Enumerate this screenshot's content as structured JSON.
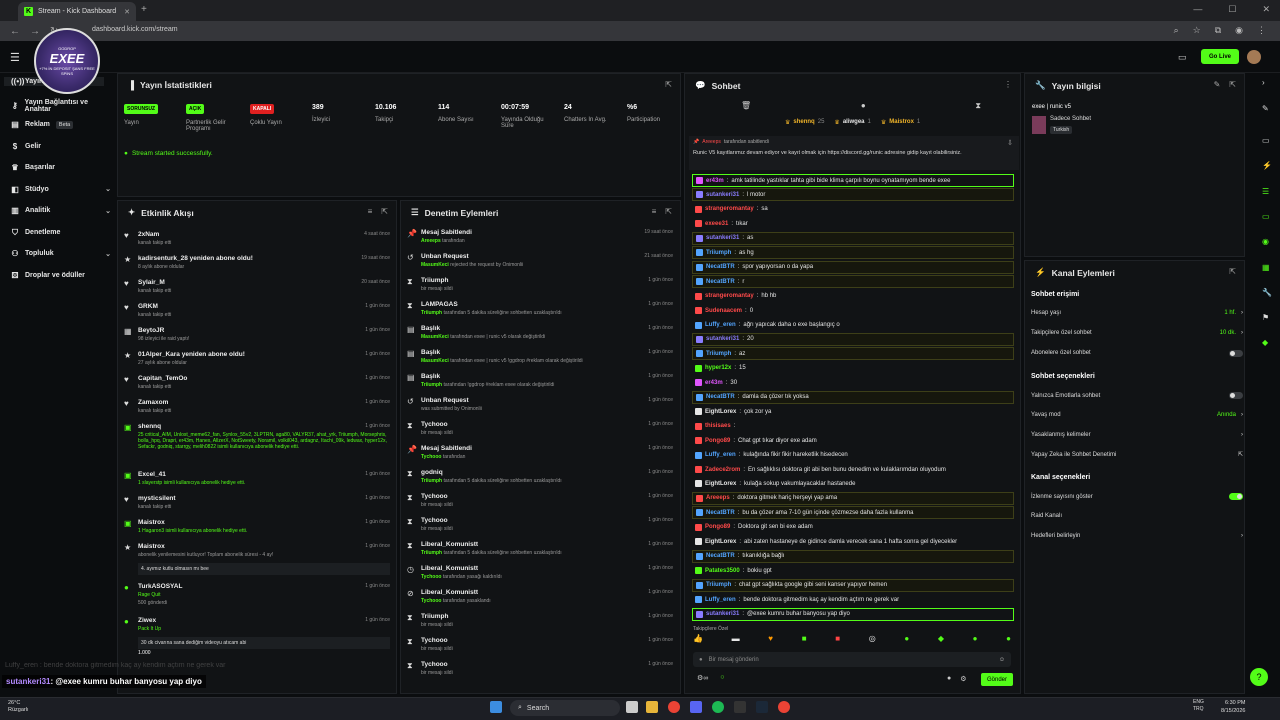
{
  "browser": {
    "tab_title": "Stream - Kick Dashboard",
    "url": "dashboard.kick.com/stream"
  },
  "header": {
    "golive": "Go Live"
  },
  "overlay": {
    "logo_top": "GODROP",
    "logo_name": "EXEE",
    "logo_sub": "+7% İN DEPOSIT ŞANS FREE SPİNS"
  },
  "sidebar": [
    {
      "label": "Yayın",
      "icon": "stream-icon",
      "chev": false
    },
    {
      "label": "Yayın Bağlantısı ve Anahtar",
      "icon": "key-icon",
      "chev": false
    },
    {
      "label": "Reklam",
      "icon": "ad-icon",
      "chev": false,
      "badge": "Beta"
    },
    {
      "label": "Gelir",
      "icon": "dollar-icon",
      "chev": false
    },
    {
      "label": "Başarılar",
      "icon": "trophy-icon",
      "chev": false
    },
    {
      "label": "Stüdyo",
      "icon": "studio-icon",
      "chev": true
    },
    {
      "label": "Analitik",
      "icon": "chart-icon",
      "chev": true
    },
    {
      "label": "Denetleme",
      "icon": "shield-icon",
      "chev": false
    },
    {
      "label": "Topluluk",
      "icon": "community-icon",
      "chev": true
    },
    {
      "label": "Droplar ve ödüller",
      "icon": "gift-icon",
      "chev": false
    }
  ],
  "stats": {
    "title": "Yayın İstatistikleri",
    "items": [
      {
        "badge": "SORUNSUZ",
        "label": "Yayın",
        "kind": "g"
      },
      {
        "badge": "AÇIK",
        "label": "Partnerlik Gelir Programı",
        "kind": "g"
      },
      {
        "badge": "KAPALI",
        "label": "Çoklu Yayın",
        "kind": "r"
      },
      {
        "value": "389",
        "label": "İzleyici"
      },
      {
        "value": "10.106",
        "label": "Takipçi"
      },
      {
        "value": "114",
        "label": "Abone Sayısı"
      },
      {
        "value": "00:07:59",
        "label": "Yayında Olduğu Süre"
      },
      {
        "value": "24",
        "label": "Chatters In Avg."
      },
      {
        "value": "%6",
        "label": "Participation"
      }
    ],
    "status": "Stream started successfully."
  },
  "activity": {
    "title": "Etkinlik Akışı",
    "rows": [
      {
        "icon": "♥",
        "name": "2xNam",
        "sub": "kanalı takip etti",
        "time": "4 saat önce"
      },
      {
        "icon": "★",
        "name": "kadirsenturk_28 yeniden abone oldu!",
        "sub": "8 aylık abone oldular",
        "time": "19 saat önce"
      },
      {
        "icon": "♥",
        "name": "Sylair_M",
        "sub": "kanalı takip etti",
        "time": "20 saat önce"
      },
      {
        "icon": "♥",
        "name": "GRKM",
        "sub": "kanalı takip etti",
        "time": "1 gün önce"
      },
      {
        "icon": "▦",
        "name": "BeytoJR",
        "sub": "98 izleyici ile raid yaptı!",
        "time": "1 gün önce"
      },
      {
        "icon": "★",
        "name": "01Alper_Kara yeniden abone oldu!",
        "sub": "27 aylık abone oldular",
        "time": "1 gün önce"
      },
      {
        "icon": "♥",
        "name": "Capitan_TemOo",
        "sub": "kanalı takip etti",
        "time": "1 gün önce"
      },
      {
        "icon": "♥",
        "name": "Zamaxom",
        "sub": "kanalı takip etti",
        "time": "1 gün önce"
      },
      {
        "icon": "▣",
        "name": "shennq",
        "sub": "25 critical_AIM, Unlost_meme62_fan, Synlox_55v2, 3LPTRN, aga80, VALYR37, ahat_yrk, Triiumph, Morsephris, bolla_hpq, Drapri, er43m, Hanex, AllzerX, NotSweety, Noramil, volkil043, ardagnz, Itachi_09k, ledwax, hyper12x, Sefackr, godniq, starrgy, melih0822 isimli kullanıcıya abonelik hediye etti.",
        "time": "1 gün önce"
      },
      {
        "icon": "▣",
        "name": "Excel_41",
        "sub": "1 slayerstp isimli kullanıcıya abonelik hediye etti.",
        "time": "1 gün önce"
      },
      {
        "icon": "♥",
        "name": "mysticsilent",
        "sub": "kanalı takip etti",
        "time": "1 gün önce"
      },
      {
        "icon": "▣",
        "name": "Maistrox",
        "sub": "1 Hagaron3 isimli kullanıcıya abonelik hediye etti.",
        "time": "1 gün önce"
      },
      {
        "icon": "★",
        "name": "Maistrox",
        "sub": "abonelik yenilemesini kutluyor! Toplam abonelik süresi - 4 ay!",
        "time": "1 gün önce",
        "quote": "4. ayımız kutlu olmasın mı bee"
      },
      {
        "icon": "●",
        "name": "TurkASOSYAL",
        "sub": "Rage Quit",
        "sub2": "500 gönderdi",
        "time": "1 gün önce"
      },
      {
        "icon": "●",
        "name": "Ziwex",
        "sub": "Pack It Up",
        "quote": "30 dk civarına sana dediğim videoyu atıcam abi",
        "amount": "1.000",
        "time": "1 gün önce"
      }
    ]
  },
  "moderation": {
    "title": "Denetim Eylemleri",
    "rows": [
      {
        "icon": "📌",
        "name": "Mesaj Sabitlendi",
        "actor": "Areeeps",
        "rest": "tarafından",
        "time": "19 saat önce"
      },
      {
        "icon": "↺",
        "name": "Unban Request",
        "actor": "MasumKeci",
        "rest": "rejected the request by Onimonlii",
        "time": "21 saat önce"
      },
      {
        "icon": "⧗",
        "name": "Triiumph",
        "actor": "",
        "rest": "bir mesajı sildi",
        "time": "1 gün önce"
      },
      {
        "icon": "⧗",
        "name": "LAMPAGAS",
        "actor": "Triiumph",
        "rest": "tarafından 5 dakika süreliğine sohbetten uzaklaştırıldı",
        "time": "1 gün önce"
      },
      {
        "icon": "▤",
        "name": "Başlık",
        "actor": "MasumKeci",
        "rest": "tarafından exee | runic v5 olarak değiştirildi",
        "time": "1 gün önce"
      },
      {
        "icon": "▤",
        "name": "Başlık",
        "actor": "MasumKeci",
        "rest": "tarafından exee | runic v5 !ggdrop #reklam olarak değiştirildi",
        "time": "1 gün önce"
      },
      {
        "icon": "▤",
        "name": "Başlık",
        "actor": "Triiumph",
        "rest": "tarafından !ggdrop #reklam exee olarak değiştirildi",
        "time": "1 gün önce"
      },
      {
        "icon": "↺",
        "name": "Unban Request",
        "actor": "",
        "rest": "was submitted by Onimonlii",
        "time": "1 gün önce"
      },
      {
        "icon": "⧗",
        "name": "Tychooo",
        "actor": "",
        "rest": "bir mesajı sildi",
        "time": "1 gün önce"
      },
      {
        "icon": "📌",
        "name": "Mesaj Sabitlendi",
        "actor": "Tychooo",
        "rest": "tarafından",
        "time": "1 gün önce"
      },
      {
        "icon": "⧗",
        "name": "godniq",
        "actor": "Triiumph",
        "rest": "tarafından 5 dakika süreliğine sohbetten uzaklaştırıldı",
        "time": "1 gün önce"
      },
      {
        "icon": "⧗",
        "name": "Tychooo",
        "actor": "",
        "rest": "bir mesajı sildi",
        "time": "1 gün önce"
      },
      {
        "icon": "⧗",
        "name": "Tychooo",
        "actor": "",
        "rest": "bir mesajı sildi",
        "time": "1 gün önce"
      },
      {
        "icon": "⧗",
        "name": "Liberal_Komunistt",
        "actor": "Triiumph",
        "rest": "tarafından 5 dakika süreliğine sohbetten uzaklaştırıldı",
        "time": "1 gün önce"
      },
      {
        "icon": "◷",
        "name": "Liberal_Komunistt",
        "actor": "Tychooo",
        "rest": "tarafından yasağı kaldırıldı",
        "time": "1 gün önce"
      },
      {
        "icon": "⊘",
        "name": "Liberal_Komunistt",
        "actor": "Tychooo",
        "rest": "tarafından yasaklandı",
        "time": "1 gün önce"
      },
      {
        "icon": "⧗",
        "name": "Triiumph",
        "actor": "",
        "rest": "bir mesajı sildi",
        "time": "1 gün önce"
      },
      {
        "icon": "⧗",
        "name": "Tychooo",
        "actor": "",
        "rest": "bir mesajı sildi",
        "time": "1 gün önce"
      },
      {
        "icon": "⧗",
        "name": "Tychooo",
        "actor": "",
        "rest": "bir mesajı sildi",
        "time": "1 gün önce"
      }
    ]
  },
  "chat": {
    "title": "Sohbet",
    "top": [
      {
        "name": "shennq",
        "n": "25",
        "color": "#f0b429"
      },
      {
        "name": "aliwgea",
        "n": "1",
        "color": "#e6e6e6"
      },
      {
        "name": "Maistrox",
        "n": "1",
        "color": "#f0b429"
      }
    ],
    "pinned_by": "tarafından sabitlendi",
    "pinned_text": "Runic V5 kayıtlarımız devam ediyor ve kayıt olmak için https://discord.gg/runic adresine gidip kayıt olabilirsiniz.",
    "messages": [
      {
        "u": "er43m",
        "c": "#e056fd",
        "t": "amk tatilinde yastıklar tahta gibi bide klima çarpılı boynu oynatamıyom bende exee",
        "cls": "gr"
      },
      {
        "u": "sutankeri31",
        "c": "#8a7dff",
        "t": "l motor",
        "cls": "hl"
      },
      {
        "u": "strangeromantay",
        "c": "#ff4a4a",
        "t": "sa",
        "cls": ""
      },
      {
        "u": "exeee31",
        "c": "#ff4a4a",
        "t": "tıkar",
        "cls": ""
      },
      {
        "u": "sutankeri31",
        "c": "#8a7dff",
        "t": "as",
        "cls": "hl"
      },
      {
        "u": "Triiumph",
        "c": "#53a5ff",
        "t": "as hg",
        "cls": "hl"
      },
      {
        "u": "NecatBTR",
        "c": "#53a5ff",
        "t": "spor yapıyorsan o da yapa",
        "cls": "hl"
      },
      {
        "u": "NecatBTR",
        "c": "#53a5ff",
        "t": "r",
        "cls": "hl"
      },
      {
        "u": "strangeromantay",
        "c": "#ff4a4a",
        "t": "hb hb",
        "cls": ""
      },
      {
        "u": "Sudenaacem",
        "c": "#ff4a4a",
        "t": "0",
        "cls": ""
      },
      {
        "u": "Luffy_eren",
        "c": "#53a5ff",
        "t": "ağrı yapıcak daha o exe başlangıç o",
        "cls": ""
      },
      {
        "u": "sutankeri31",
        "c": "#8a7dff",
        "t": "20",
        "cls": "hl"
      },
      {
        "u": "Triiumph",
        "c": "#53a5ff",
        "t": "az",
        "cls": "hl"
      },
      {
        "u": "hyper12x",
        "c": "#53fc18",
        "t": "15",
        "cls": ""
      },
      {
        "u": "er43m",
        "c": "#e056fd",
        "t": "30",
        "cls": ""
      },
      {
        "u": "NecatBTR",
        "c": "#53a5ff",
        "t": "damla da çözer tık yoksa",
        "cls": "hl"
      },
      {
        "u": "EightLorex",
        "c": "#e6e6e6",
        "t": "çok zor ya",
        "cls": ""
      },
      {
        "u": "thisisaes",
        "c": "#ff4a4a",
        "t": "",
        "cls": ""
      },
      {
        "u": "Pongo89",
        "c": "#ff4a4a",
        "t": "Chat gpt tıkar diyor exe adam",
        "cls": ""
      },
      {
        "u": "Luffy_eren",
        "c": "#53a5ff",
        "t": "kulağında fikir fikir hareketlik hisedecen",
        "cls": ""
      },
      {
        "u": "Zadece2rom",
        "c": "#ff4a4a",
        "t": "En sağlıklısı doktora git abi ben bunu denedim ve kulaklarımdan oluyodum",
        "cls": ""
      },
      {
        "u": "EightLorex",
        "c": "#e6e6e6",
        "t": "kulağa sokup vakumlayacaklar hastanede",
        "cls": ""
      },
      {
        "u": "Areeeps",
        "c": "#ff4a4a",
        "t": "doktora gitmek hariç herşeyi yap ama",
        "cls": "hl"
      },
      {
        "u": "NecatBTR",
        "c": "#53a5ff",
        "t": "bu da çözer ama 7-10 gün içinde çözmezse daha fazla kullanma",
        "cls": "hl"
      },
      {
        "u": "Pongo89",
        "c": "#ff4a4a",
        "t": "Doktora git sen bi exe adam",
        "cls": ""
      },
      {
        "u": "EightLorex",
        "c": "#e6e6e6",
        "t": "abi zaten hastaneye de gidince damla verecek sana 1 hafta sonra gel diyecekler",
        "cls": ""
      },
      {
        "u": "NecatBTR",
        "c": "#53a5ff",
        "t": "tıkanıklığa bağlı",
        "cls": "hl"
      },
      {
        "u": "Patates3500",
        "c": "#53fc18",
        "t": "bokiu gpt",
        "cls": ""
      },
      {
        "u": "Triiumph",
        "c": "#53a5ff",
        "t": "chat gpt sağlıkta google gibi seni kanser yapıyor hemen",
        "cls": "hl"
      },
      {
        "u": "Luffy_eren",
        "c": "#53a5ff",
        "t": "bende doktora gitmedim kaç ay kendim açtım ne gerek var",
        "cls": ""
      },
      {
        "u": "sutankeri31",
        "c": "#8a7dff",
        "t": "@exee kumru buhar banyosu yap diyo",
        "cls": "gr"
      }
    ],
    "followers_only": "Takipçilere Özel",
    "placeholder": "Bir mesaj gönderin",
    "send": "Gönder"
  },
  "info": {
    "title": "Yayın bilgisi",
    "stream_title": "exee | runic v5",
    "category": "Sadece Sohbet",
    "lang": "Turkish"
  },
  "actions": {
    "title": "Kanal Eylemleri",
    "chat_access": "Sohbet erişimi",
    "rows1": [
      {
        "label": "Hesap yaşı",
        "value": "1 hf.",
        "ctl": "chev"
      },
      {
        "label": "Takipçilere özel sohbet",
        "value": "10 dk.",
        "ctl": "chev"
      },
      {
        "label": "Abonelere özel sohbet",
        "value": "",
        "ctl": "off"
      }
    ],
    "chat_opts": "Sohbet seçenekleri",
    "rows2": [
      {
        "label": "Yalnızca Emotlarla sohbet",
        "value": "",
        "ctl": "off"
      },
      {
        "label": "Yavaş mod",
        "value": "Anında",
        "ctl": "chev"
      },
      {
        "label": "Yasaklanmış kelimeler",
        "value": "",
        "ctl": "chev"
      },
      {
        "label": "Yapay Zeka ile Sohbet Denetimi",
        "value": "",
        "ctl": "ext"
      }
    ],
    "channel_opts": "Kanal seçenekleri",
    "rows3": [
      {
        "label": "İzlenme sayısını göster",
        "value": "",
        "ctl": "on"
      },
      {
        "label": "Raid Kanalı",
        "value": "",
        "ctl": ""
      },
      {
        "label": "Hedefleri belirleyin",
        "value": "",
        "ctl": "chev"
      }
    ]
  },
  "bottom_overlay": {
    "faded": "Luffy_eren : bende doktora gitmedim kaç ay kendim açtım ne gerek var",
    "user": "sutankeri31",
    "msg": ": @exee kumru buhar banyosu yap diyo"
  },
  "taskbar": {
    "temp": "26°C",
    "weather": "Rüzgarlı",
    "search": "Search",
    "lang1": "ENG",
    "lang2": "TRQ",
    "time": "6:30 PM",
    "date": "8/15/2026"
  }
}
